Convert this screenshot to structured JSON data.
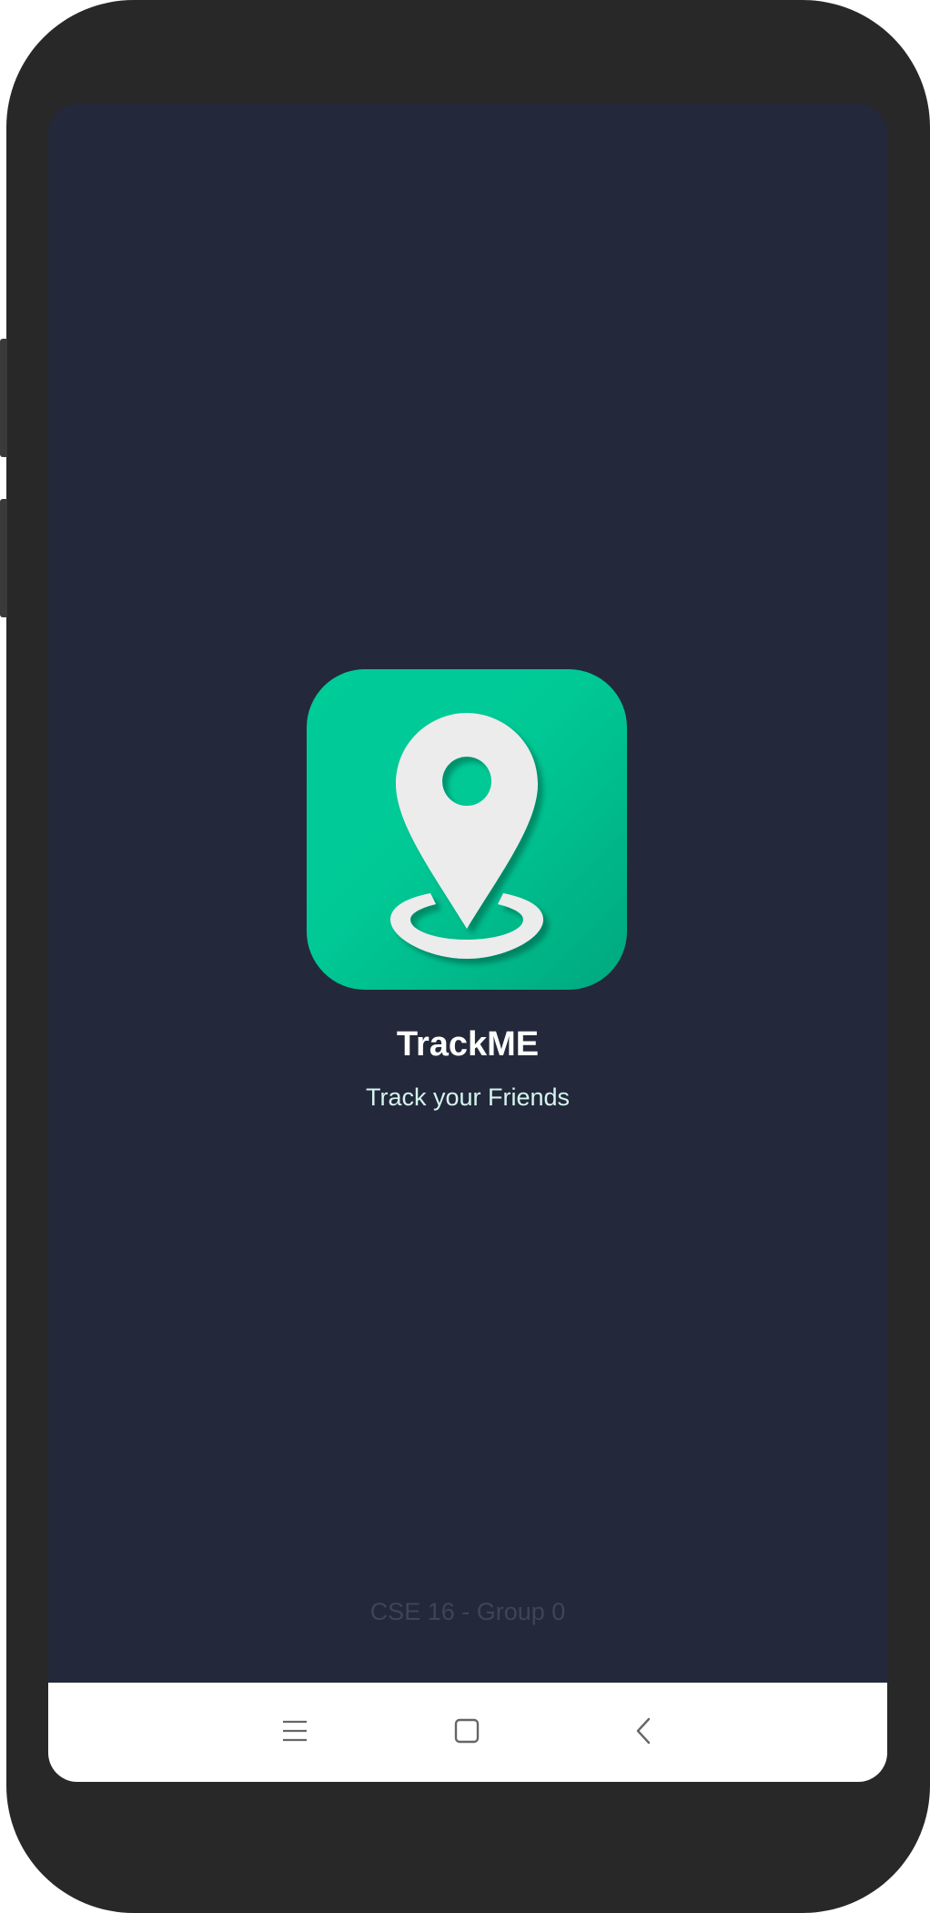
{
  "app": {
    "title": "TrackME",
    "tagline": "Track your Friends",
    "credit": "CSE 16 - Group 0"
  },
  "icons": {
    "app_icon": "location-pin-icon",
    "nav_menu": "menu-icon",
    "nav_home": "home-square-icon",
    "nav_back": "back-chevron-icon"
  },
  "colors": {
    "screen_background": "#23293a",
    "icon_accent": "#00cc99",
    "nav_bar": "#ffffff",
    "phone_frame": "#282828"
  }
}
